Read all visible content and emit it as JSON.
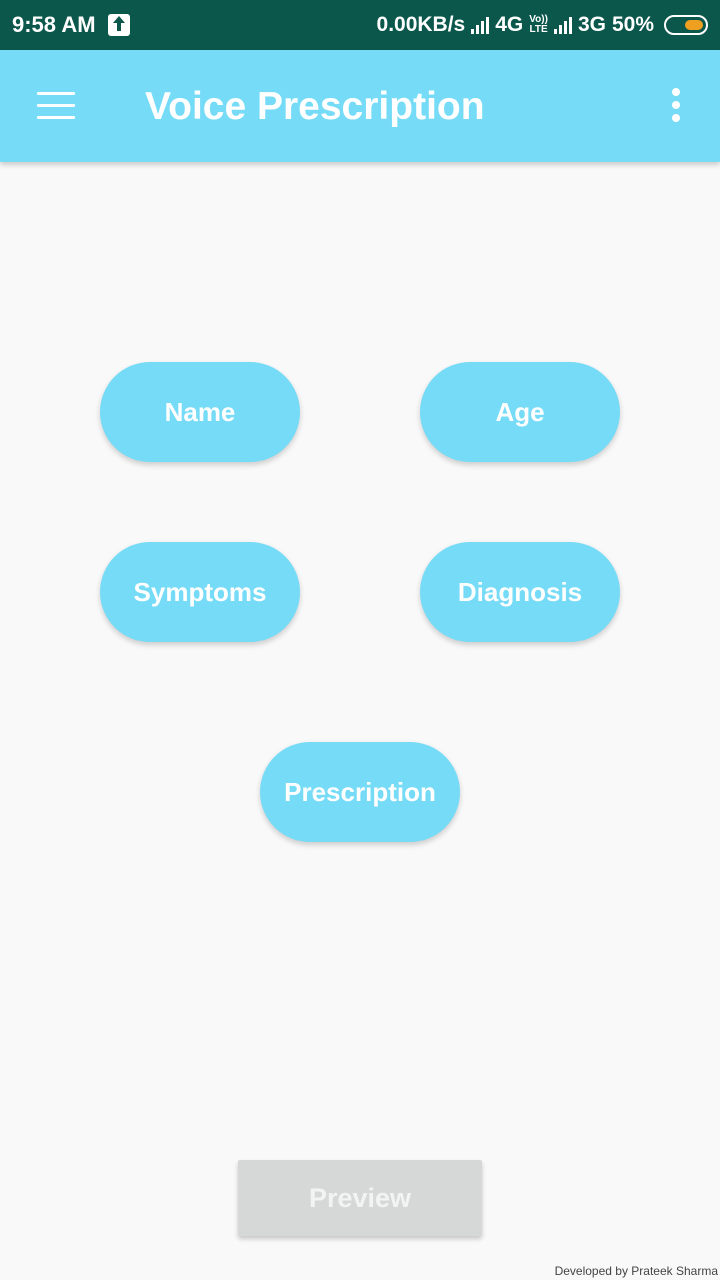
{
  "status_bar": {
    "time": "9:58 AM",
    "speed": "0.00KB/s",
    "network1": "4G",
    "volte_top": "Vo))",
    "volte_bottom": "LTE",
    "network2": "3G",
    "battery": "50%",
    "battery_level": 0.5
  },
  "app_bar": {
    "title": "Voice Prescription",
    "background": "#76dbf6"
  },
  "fields": {
    "name": "Name",
    "age": "Age",
    "symptoms": "Symptoms",
    "diagnosis": "Diagnosis",
    "prescription": "Prescription"
  },
  "preview_label": "Preview",
  "footer": "Developed by Prateek Sharma",
  "colors": {
    "status_bar": "#0b574b",
    "accent": "#76dbf6",
    "preview_disabled": "#d6d7d7"
  }
}
